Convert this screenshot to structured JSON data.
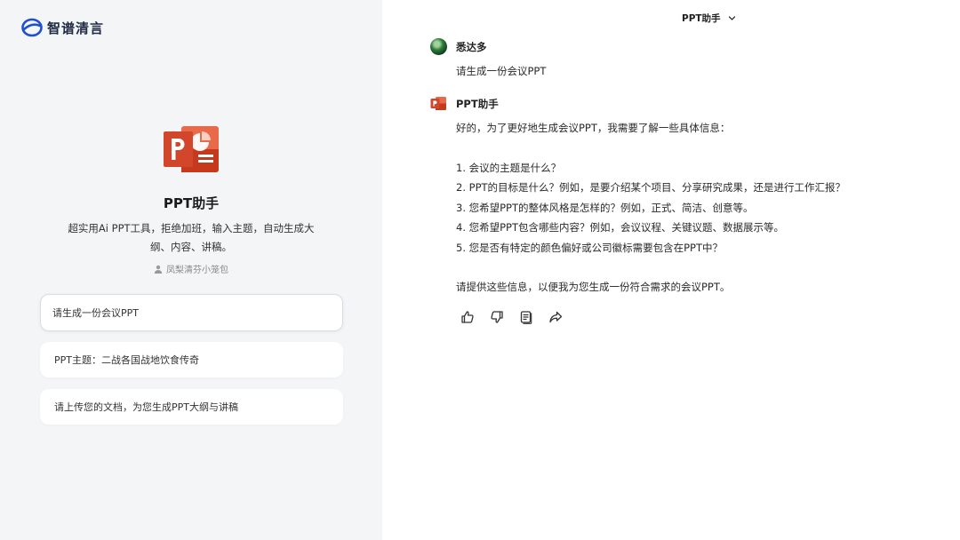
{
  "brand": {
    "name": "智谱清言",
    "logo_icon": "zhipu-logo-icon"
  },
  "agent": {
    "icon": "powerpoint-icon",
    "title": "PPT助手",
    "description": "超实用Ai PPT工具，拒绝加班，输入主题，自动生成大纲、内容、讲稿。",
    "author_icon": "user-icon",
    "author": "凤梨清芬小笼包"
  },
  "suggestions": [
    "请生成一份会议PPT",
    "PPT主题：二战各国战地饮食传奇",
    "请上传您的文档，为您生成PPT大纲与讲稿"
  ],
  "header": {
    "model_label": "PPT助手",
    "dropdown_icon": "chevron-down-icon"
  },
  "conversation": {
    "user": {
      "name": "悉达多",
      "message": "请生成一份会议PPT"
    },
    "assistant": {
      "name": "PPT助手",
      "intro": "好的，为了更好地生成会议PPT，我需要了解一些具体信息：",
      "questions": [
        "1. 会议的主题是什么？",
        "2. PPT的目标是什么？例如，是要介绍某个项目、分享研究成果，还是进行工作汇报？",
        "3. 您希望PPT的整体风格是怎样的？例如，正式、简洁、创意等。",
        "4. 您希望PPT包含哪些内容？例如，会议议程、关键议题、数据展示等。",
        "5. 您是否有特定的颜色偏好或公司徽标需要包含在PPT中？"
      ],
      "closing": "请提供这些信息，以便我为您生成一份符合需求的会议PPT。"
    }
  },
  "message_actions": [
    "thumbs-up-icon",
    "thumbs-down-icon",
    "copy-icon",
    "share-icon"
  ],
  "colors": {
    "left_bg": "#f4f5f7",
    "ppt_orange": "#d2472b",
    "brand_blue": "#1f4fd1"
  }
}
